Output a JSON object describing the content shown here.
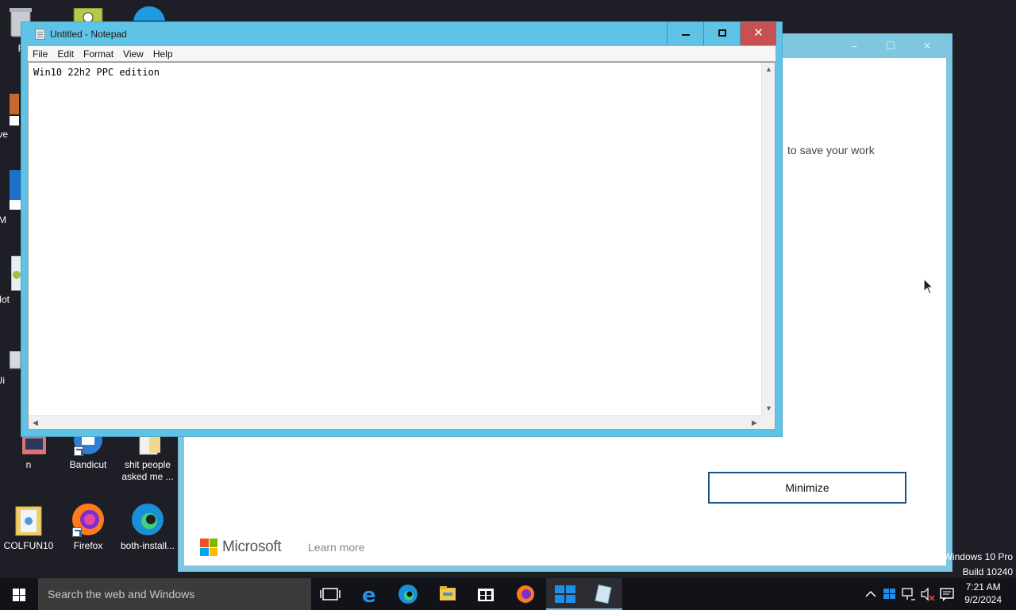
{
  "desktop": {
    "icons": [
      {
        "label": "Rec"
      },
      {
        "label": "Eve"
      },
      {
        "label": "M"
      },
      {
        "label": "Not"
      },
      {
        "label": "Ui"
      },
      {
        "label": "n"
      },
      {
        "label": "Bandicut"
      },
      {
        "label": "shit people asked me ..."
      },
      {
        "label": "COLFUN10"
      },
      {
        "label": "Firefox"
      },
      {
        "label": "both-install..."
      }
    ]
  },
  "background_window": {
    "body_text": "to save your work",
    "minimize_button": "Minimize",
    "brand": "Microsoft",
    "learn_more": "Learn more",
    "caption_min": "‒",
    "caption_max": "☐",
    "caption_close": "✕"
  },
  "notepad": {
    "title": "Untitled - Notepad",
    "menu": [
      "File",
      "Edit",
      "Format",
      "View",
      "Help"
    ],
    "content": "Win10 22h2 PPC edition",
    "close_glyph": "✕"
  },
  "watermark": {
    "line1": "Windows 10 Pro",
    "line2": "Build 10240"
  },
  "taskbar": {
    "search_placeholder": "Search the web and Windows",
    "time": "7:21 AM",
    "date": "9/2/2024"
  },
  "colors": {
    "accent": "#60c3e6",
    "close_red": "#c75050"
  }
}
